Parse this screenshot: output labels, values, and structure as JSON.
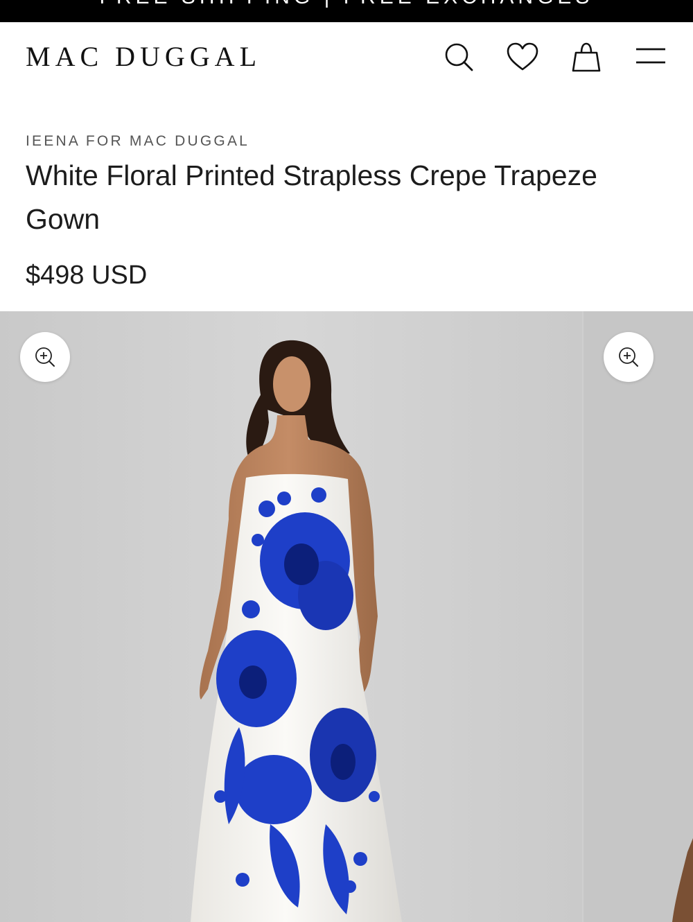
{
  "promo": {
    "text": "FREE SHIPPING | FREE EXCHANGES"
  },
  "header": {
    "logo": "MAC DUGGAL",
    "icons": [
      "search-icon",
      "heart-icon",
      "bag-icon",
      "menu-icon"
    ]
  },
  "product": {
    "brand": "IEENA FOR MAC DUGGAL",
    "title": "White Floral Printed Strapless Crepe Trapeze Gown",
    "price": "$498 USD"
  },
  "gallery": {
    "zoom_icon": "zoom-in-icon",
    "image": "model in strapless white gown with large blue floral print"
  },
  "colors": {
    "promo_bg": "#000000",
    "backdrop": "#cfcfcf",
    "floral_blue": "#1e3fc8"
  }
}
